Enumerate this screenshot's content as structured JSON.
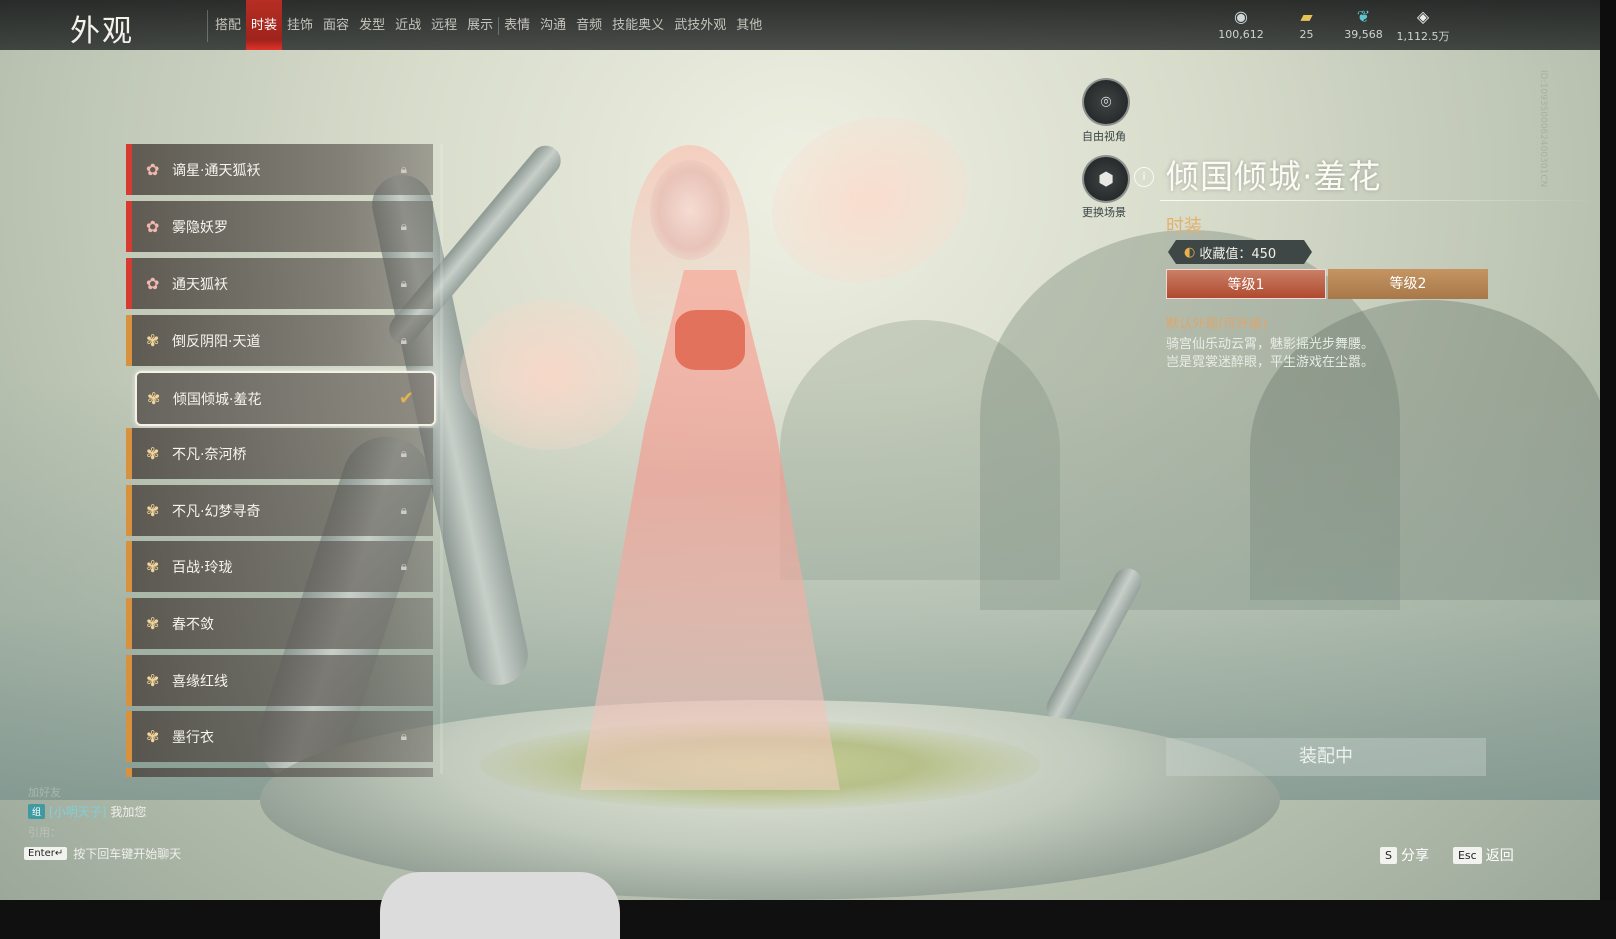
{
  "header": {
    "title": "外观",
    "tabs": [
      "搭配",
      "时装",
      "挂饰",
      "面容",
      "发型",
      "近战",
      "远程",
      "展示",
      "表情",
      "沟通",
      "音频",
      "技能奥义",
      "武技外观",
      "其他"
    ],
    "active_tab": "时装"
  },
  "currencies": [
    {
      "icon": "silver-coin-icon",
      "value": "100,612"
    },
    {
      "icon": "gold-ingot-icon",
      "value": "25"
    },
    {
      "icon": "jade-feather-icon",
      "value": "39,568"
    },
    {
      "icon": "diamond-token-icon",
      "value": "1,112.5万"
    }
  ],
  "outfit_list": {
    "items": [
      {
        "name": "谪星·通天狐袄",
        "rarity": "red",
        "locked": true,
        "selected": false
      },
      {
        "name": "雾隐妖罗",
        "rarity": "red",
        "locked": true,
        "selected": false
      },
      {
        "name": "通天狐袄",
        "rarity": "red",
        "locked": true,
        "selected": false
      },
      {
        "name": "倒反阴阳·天道",
        "rarity": "orange",
        "locked": true,
        "selected": false
      },
      {
        "name": "倾国倾城·羞花",
        "rarity": "orange",
        "locked": false,
        "selected": true
      },
      {
        "name": "不凡·奈河桥",
        "rarity": "orange",
        "locked": true,
        "selected": false
      },
      {
        "name": "不凡·幻梦寻奇",
        "rarity": "orange",
        "locked": true,
        "selected": false
      },
      {
        "name": "百战·玲珑",
        "rarity": "orange",
        "locked": true,
        "selected": false
      },
      {
        "name": "春不敛",
        "rarity": "orange",
        "locked": false,
        "selected": false
      },
      {
        "name": "喜缘红线",
        "rarity": "orange",
        "locked": false,
        "selected": false
      },
      {
        "name": "墨行衣",
        "rarity": "orange",
        "locked": true,
        "selected": false
      }
    ]
  },
  "camera": {
    "free_view_label": "自由视角",
    "change_scene_label": "更换场景"
  },
  "detail": {
    "title": "倾国倾城·羞花",
    "category": "时装",
    "collect_label": "收藏值：450",
    "levels": [
      "等级1",
      "等级2"
    ],
    "active_level": "等级1",
    "default_label": "默认外观(可升级)",
    "desc_line1": "骑宫仙乐动云霄，魅影摇光步舞腰。",
    "desc_line2": "岂是霓裳迷醉眼，平生游戏在尘嚣。",
    "equip_label": "装配中"
  },
  "chat": {
    "faded_line": "                  加好友",
    "tag": "组",
    "nick": "[小明天子]",
    "msg": "我加您",
    "faded_line2": "引用：",
    "hint_key": "Enter↵",
    "hint_text": "按下回车键开始聊天"
  },
  "footer": {
    "share_key": "S",
    "share_label": "分享",
    "back_key": "Esc",
    "back_label": "返回"
  },
  "watermark": "ID:1093500062400301CN"
}
